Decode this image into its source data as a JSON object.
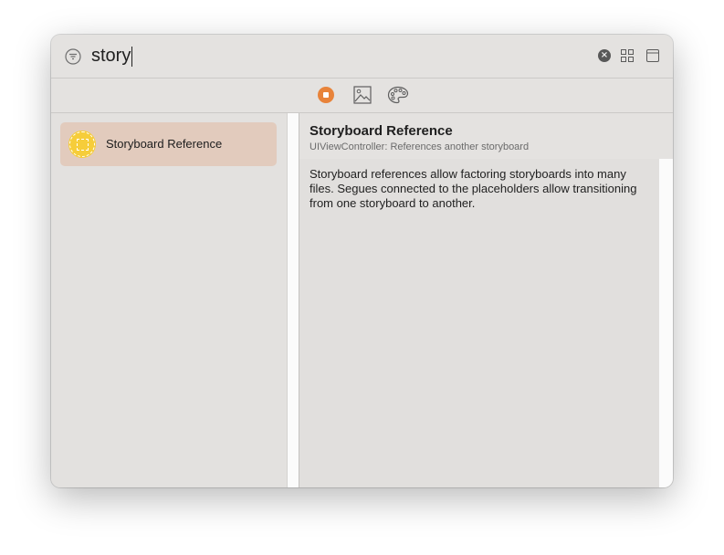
{
  "search": {
    "value": "story"
  },
  "icons": {
    "filter": "filter-icon",
    "clear": "clear-icon",
    "grid_view": "grid-icon",
    "panel": "panel-icon",
    "objects_tab": "objects-icon",
    "media_tab": "image-icon",
    "colors_tab": "palette-icon",
    "clear_glyph": "×"
  },
  "colors": {
    "accent": "#e8833a",
    "selection": "#e2cbbd",
    "item_icon": "#f6cd3a"
  },
  "library": {
    "items": [
      {
        "label": "Storyboard Reference",
        "selected": true
      }
    ]
  },
  "detail": {
    "title": "Storyboard Reference",
    "subtitle": "UIViewController: References another storyboard",
    "description": "Storyboard references allow factoring storyboards into many files. Segues connected to the placeholders allow transitioning from one storyboard to another."
  }
}
